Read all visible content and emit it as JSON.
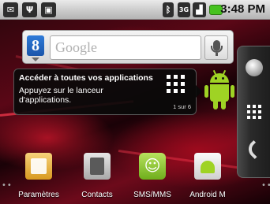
{
  "status_bar": {
    "left_icons": [
      "notification-icon",
      "usb-icon",
      "android-notification-icon"
    ],
    "right_icons": [
      "bluetooth-icon",
      "3g-icon",
      "signal-icon",
      "battery-icon"
    ],
    "time": "3:48 PM"
  },
  "search_widget": {
    "placeholder": "Google",
    "logo_letter": "8"
  },
  "tooltip": {
    "title": "Accéder à toutes vos applications",
    "body": "Appuyez sur le lanceur d'applications.",
    "page_indicator": "1 sur 6"
  },
  "right_dock": {
    "items": [
      "browser-icon",
      "launcher-icon",
      "phone-icon"
    ]
  },
  "shortcuts": [
    {
      "label": "Paramètres",
      "icon": "settings-icon"
    },
    {
      "label": "Contacts",
      "icon": "contacts-icon"
    },
    {
      "label": "SMS/MMS",
      "icon": "sms-icon"
    },
    {
      "label": "Android M",
      "icon": "market-icon"
    }
  ],
  "colors": {
    "android_green": "#9fd324",
    "wallpaper_red": "#6d0a1b"
  }
}
